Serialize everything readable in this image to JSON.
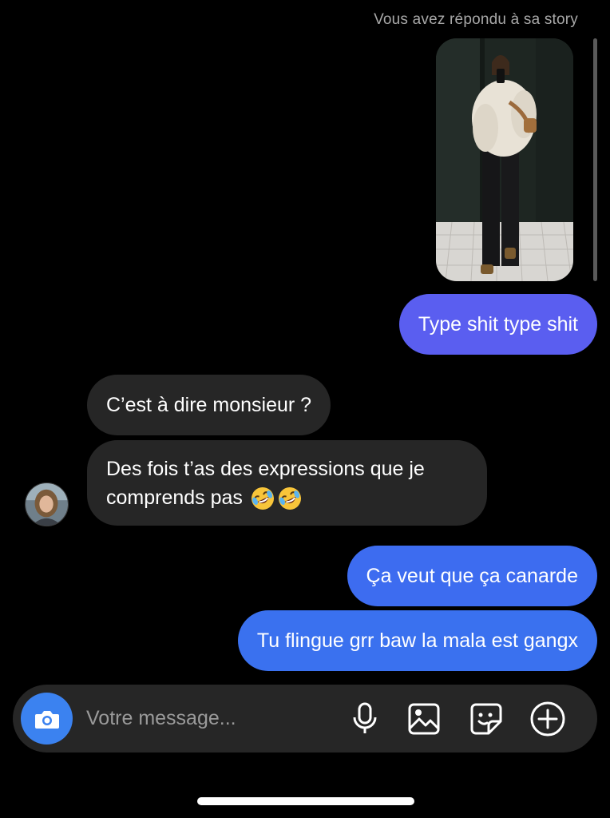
{
  "header": {
    "story_reply_note": "Vous avez répondu à sa story"
  },
  "messages": [
    {
      "direction": "outgoing",
      "text": "Type shit type shit"
    },
    {
      "direction": "incoming",
      "text": "C’est à dire monsieur ?"
    },
    {
      "direction": "incoming",
      "text": "Des fois t’as des expressions que je comprends pas"
    },
    {
      "direction": "outgoing",
      "text": "Ça veut que ça canarde"
    },
    {
      "direction": "outgoing",
      "text": "Tu flingue grr baw la mala est gangx"
    }
  ],
  "emoji": [
    "rofl-emoji",
    "rofl-emoji"
  ],
  "composer": {
    "placeholder": "Votre message...",
    "icons": [
      "camera-icon",
      "microphone-icon",
      "gallery-icon",
      "sticker-icon",
      "add-icon"
    ]
  },
  "colors": {
    "background": "#000000",
    "incoming_bubble": "#262626",
    "outgoing_bubble_top": "#5a5ef0",
    "outgoing_bubble_bottom": "#3a71ef",
    "camera_button": "#3b82f0",
    "meta_text": "#a8a8a8"
  }
}
